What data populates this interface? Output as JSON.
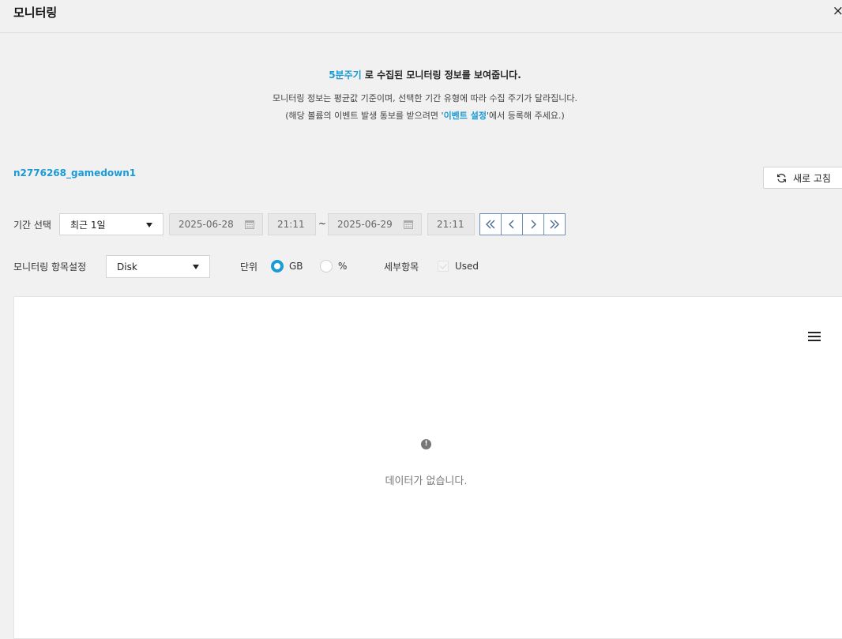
{
  "header": {
    "title": "모니터링",
    "close_glyph": "×"
  },
  "info": {
    "line1_highlight": "5분주기",
    "line1_rest": " 로 수집된 모니터링 정보를 보여줍니다.",
    "line2": "모니터링 정보는 평균값 기준이며, 선택한 기간 유형에 따라 수집 주기가 달라집니다.",
    "line3_prefix": "(해당 볼륨의 이벤트 발생 통보를 받으려면 '",
    "line3_link": "이벤트 설정",
    "line3_suffix": "'에서 등록해 주세요.)"
  },
  "volume_name": "n2776268_gamedown1",
  "refresh_label": "새로 고침",
  "period": {
    "label": "기간 선택",
    "selected": "최근 1일",
    "start_date": "2025-06-28",
    "start_time": "21:11",
    "separator": "~",
    "end_date": "2025-06-29",
    "end_time": "21:11"
  },
  "monitor": {
    "label": "모니터링 항목설정",
    "selected": "Disk",
    "unit_label": "단위",
    "unit_options": [
      "GB",
      "%"
    ],
    "unit_selected": "GB",
    "detail_label": "세부항목",
    "detail_item": "Used"
  },
  "chart": {
    "empty_message": "데이터가 없습니다.",
    "empty_icon_glyph": "!"
  },
  "colors": {
    "accent": "#1a9bd7",
    "nav_border": "#6f8fb7",
    "background": "#f1f1f1"
  },
  "icons": [
    "close-icon",
    "refresh-icon",
    "calendar-icon",
    "double-chevron-left-icon",
    "chevron-left-icon",
    "chevron-right-icon",
    "double-chevron-right-icon",
    "hamburger-menu-icon",
    "exclamation-icon"
  ]
}
